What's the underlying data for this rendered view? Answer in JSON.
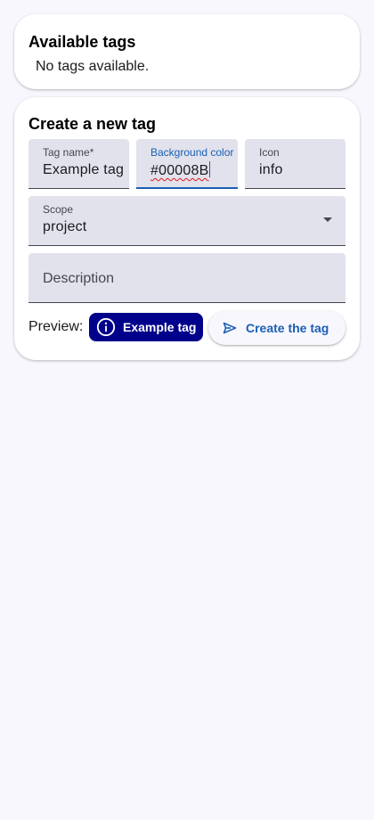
{
  "available_tags": {
    "title": "Available tags",
    "empty_message": "No tags available."
  },
  "create_tag": {
    "title": "Create a new tag",
    "fields": {
      "tag_name": {
        "label": "Tag name*",
        "value": "Example tag"
      },
      "background_color": {
        "label": "Background color",
        "value": "#00008B"
      },
      "icon": {
        "label": "Icon",
        "value": "info"
      },
      "scope": {
        "label": "Scope",
        "value": "project"
      },
      "description": {
        "placeholder": "Description",
        "value": ""
      }
    },
    "preview": {
      "label": "Preview:",
      "chip_text": "Example tag",
      "chip_icon": "info-icon",
      "chip_color": "#00008B",
      "chip_text_color": "#FFFFFF"
    },
    "create_button": {
      "label": "Create the tag",
      "icon": "send-icon"
    }
  },
  "colors": {
    "background": "#F8F7FD",
    "card": "#FFFFFF",
    "field_fill": "#E1E2EC",
    "accent": "#1A5FB4",
    "spellcheck": "#E01B24"
  }
}
